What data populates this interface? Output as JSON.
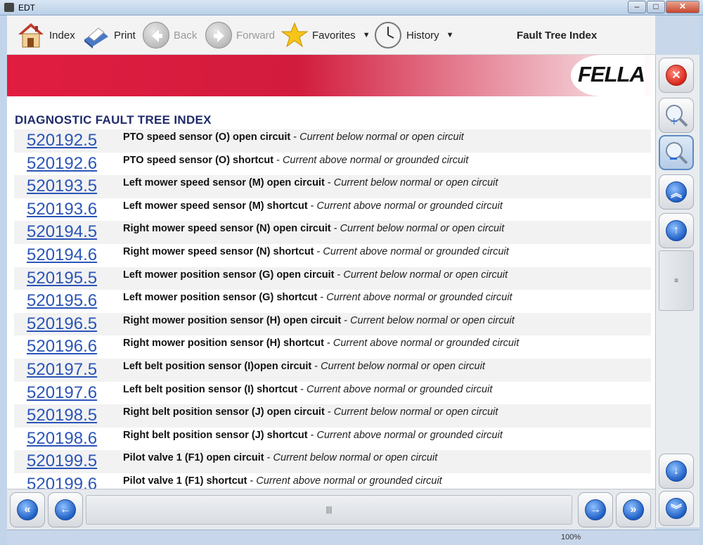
{
  "window": {
    "title": "EDT",
    "min": "–",
    "max": "□",
    "close": "✕"
  },
  "toolbar": {
    "index_label": "Index",
    "print_label": "Print",
    "back_label": "Back",
    "forward_label": "Forward",
    "favorites_label": "Favorites",
    "history_label": "History",
    "page_title": "Fault Tree Index"
  },
  "brand": {
    "logo_text": "FELLA",
    "accent_color": "#e01d41"
  },
  "content": {
    "heading": "DIAGNOSTIC FAULT TREE INDEX",
    "rows": [
      {
        "code": "520192.5",
        "title": "PTO speed sensor (O) open circuit",
        "detail": "Current below normal or open circuit"
      },
      {
        "code": "520192.6",
        "title": "PTO speed sensor (O) shortcut",
        "detail": "Current above normal or grounded circuit"
      },
      {
        "code": "520193.5",
        "title": "Left mower speed sensor (M) open circuit",
        "detail": "Current below normal or open circuit"
      },
      {
        "code": "520193.6",
        "title": "Left mower speed sensor (M) shortcut",
        "detail": "Current above normal or grounded circuit"
      },
      {
        "code": "520194.5",
        "title": "Right mower speed sensor (N) open circuit",
        "detail": "Current below normal or open circuit"
      },
      {
        "code": "520194.6",
        "title": "Right mower speed sensor (N) shortcut",
        "detail": "Current above normal or grounded circuit"
      },
      {
        "code": "520195.5",
        "title": "Left mower position sensor (G) open circuit",
        "detail": "Current below normal or open circuit"
      },
      {
        "code": "520195.6",
        "title": "Left mower position sensor (G) shortcut",
        "detail": "Current above normal or grounded circuit"
      },
      {
        "code": "520196.5",
        "title": "Right mower position sensor (H) open circuit",
        "detail": "Current below normal or open circuit"
      },
      {
        "code": "520196.6",
        "title": "Right mower position sensor (H) shortcut",
        "detail": "Current above normal or grounded circuit"
      },
      {
        "code": "520197.5",
        "title": "Left belt position sensor (I)open circuit",
        "detail": "Current below normal or open circuit"
      },
      {
        "code": "520197.6",
        "title": "Left belt position sensor (I) shortcut",
        "detail": "Current above normal or grounded circuit"
      },
      {
        "code": "520198.5",
        "title": "Right belt position sensor (J) open circuit",
        "detail": "Current below normal or open circuit"
      },
      {
        "code": "520198.6",
        "title": "Right belt position sensor (J) shortcut",
        "detail": "Current above normal or grounded circuit"
      },
      {
        "code": "520199.5",
        "title": "Pilot valve 1 (F1) open circuit",
        "detail": "Current below normal or open circuit"
      },
      {
        "code": "520199.6",
        "title": "Pilot valve 1 (F1) shortcut",
        "detail": "Current above normal or grounded circuit"
      }
    ],
    "separator": " - "
  },
  "scroll": {
    "grip": "≡",
    "hgrip": "|||"
  },
  "status": {
    "zoom": "100%"
  }
}
